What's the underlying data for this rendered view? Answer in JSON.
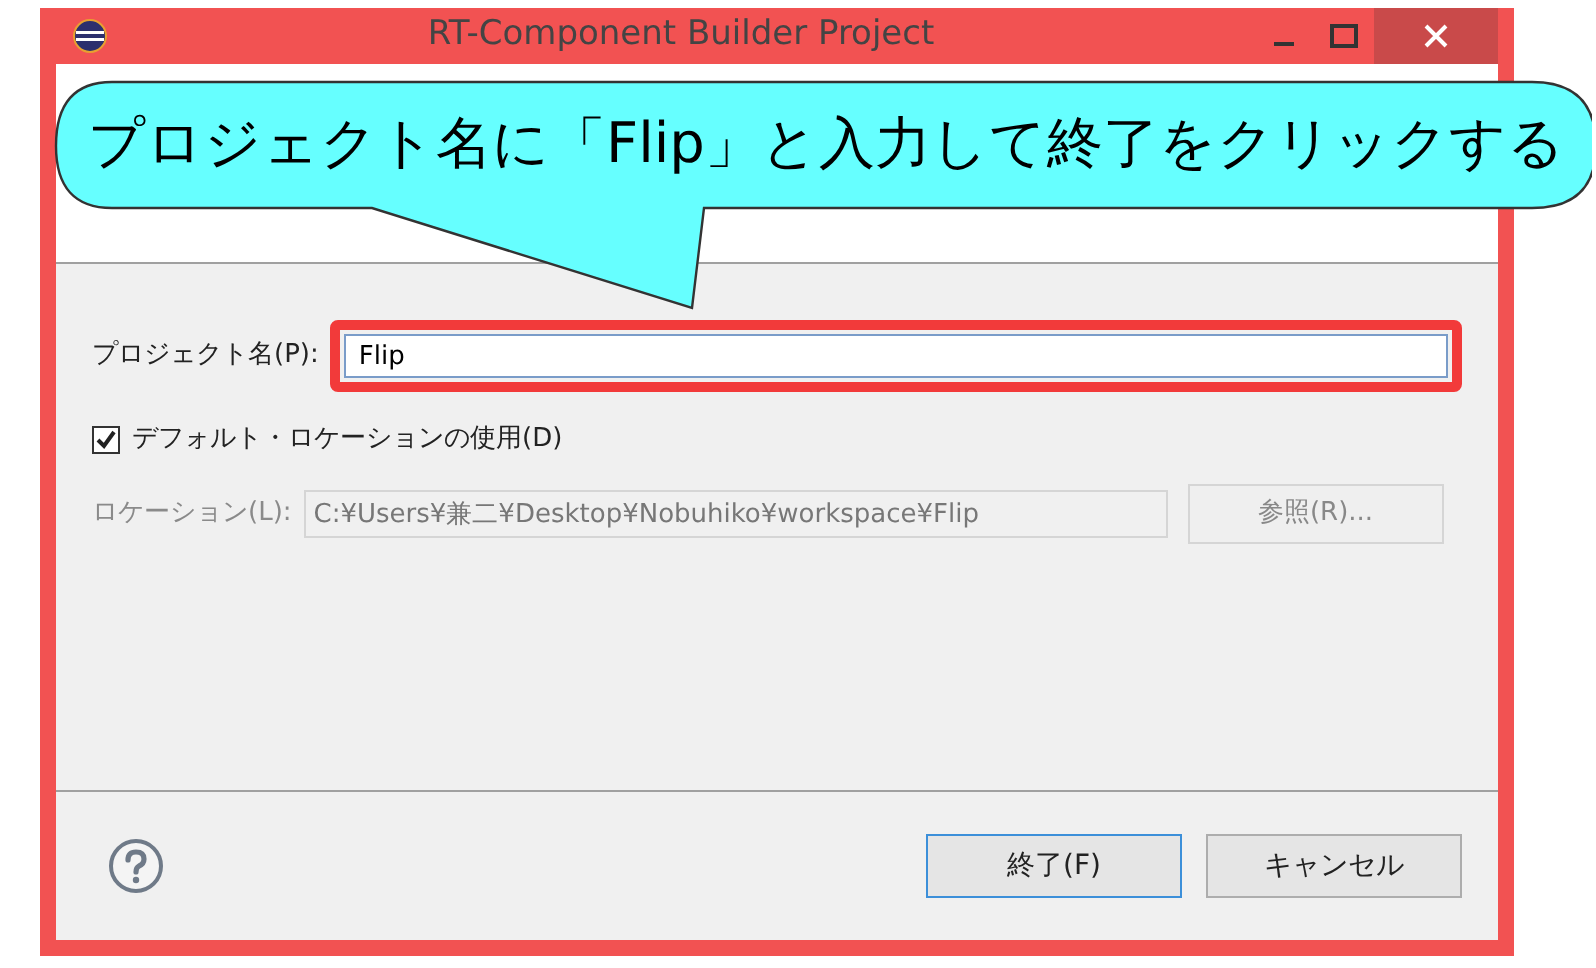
{
  "window": {
    "title": "RT-Component Builder Project"
  },
  "callout": {
    "text": "プロジェクト名に「Flip」と入力して終了をクリックする"
  },
  "project_name": {
    "label": "プロジェクト名(P):",
    "value": "Flip",
    "highlighted": true
  },
  "default_location": {
    "label": "デフォルト・ロケーションの使用(D)",
    "checked": true
  },
  "location": {
    "label": "ロケーション(L):",
    "value": "C:¥Users¥兼二¥Desktop¥Nobuhiko¥workspace¥Flip",
    "disabled": true
  },
  "browse_button": {
    "label": "参照(R)...",
    "disabled": true
  },
  "buttons": [
    {
      "label": "終了(F)",
      "default": true
    },
    {
      "label": "キャンセル",
      "default": false
    }
  ]
}
